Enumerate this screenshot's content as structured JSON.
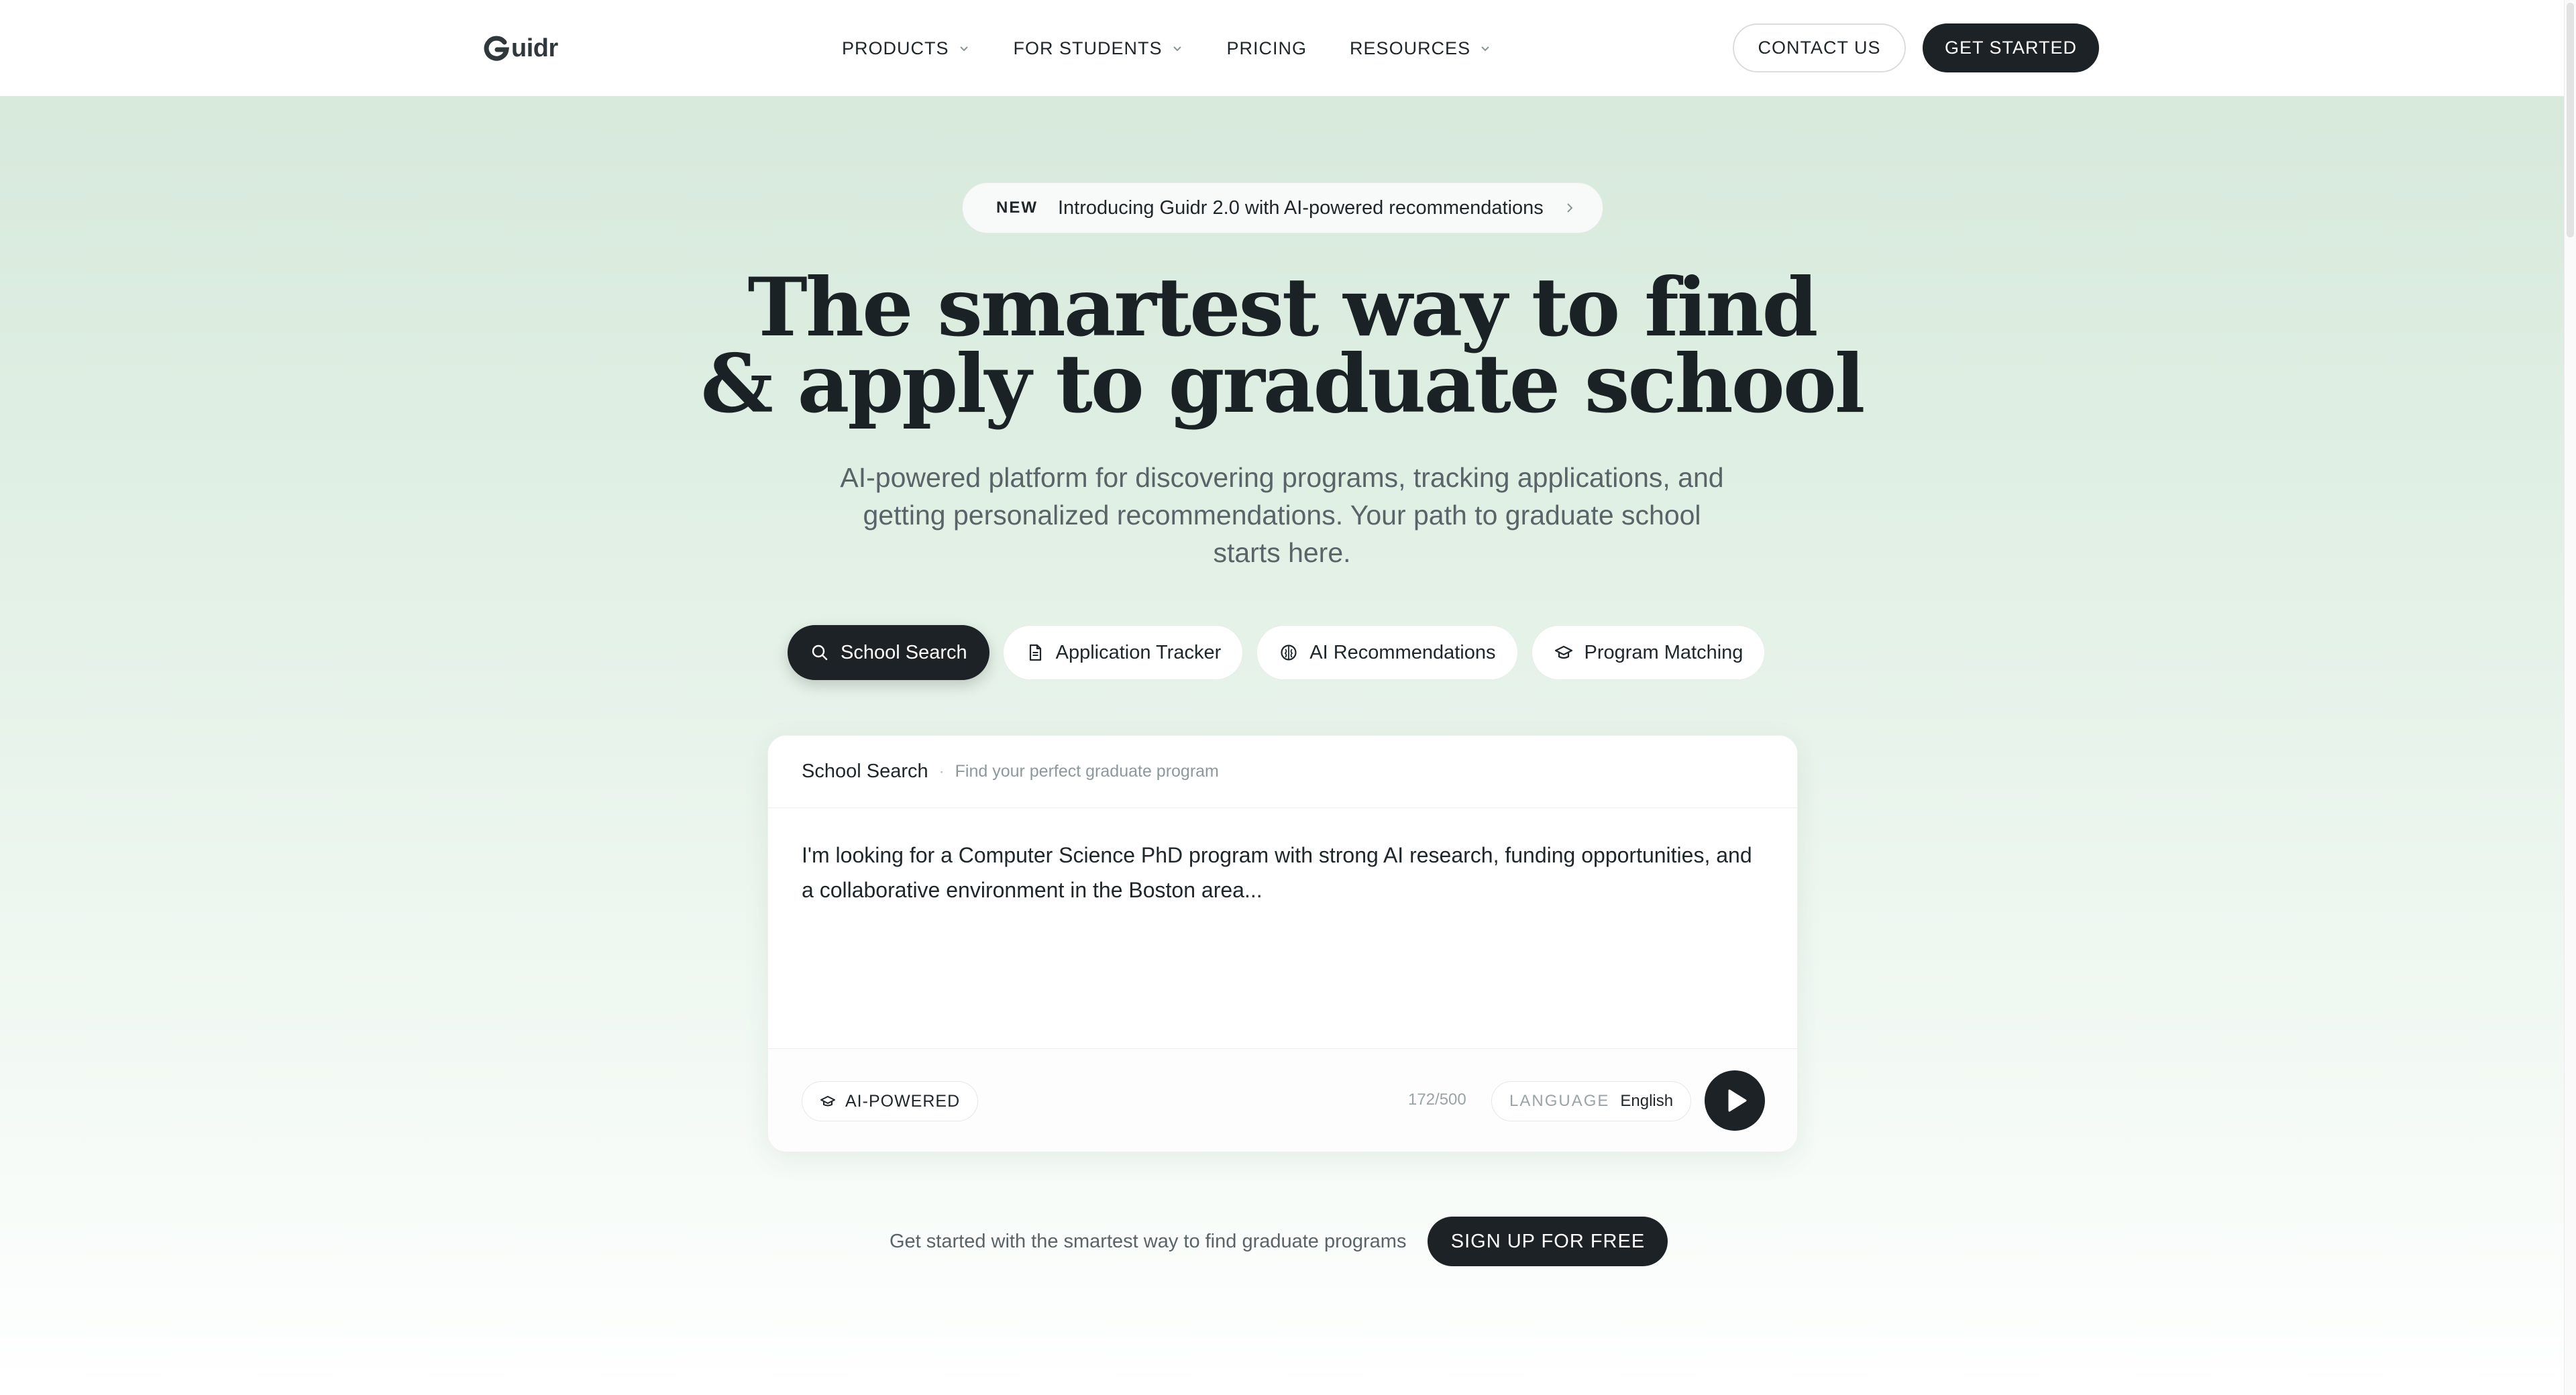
{
  "nav": {
    "logo": "uidr",
    "menu": [
      {
        "label": "PRODUCTS",
        "has_dropdown": true
      },
      {
        "label": "FOR STUDENTS",
        "has_dropdown": true
      },
      {
        "label": "PRICING",
        "has_dropdown": false
      },
      {
        "label": "RESOURCES",
        "has_dropdown": true
      }
    ],
    "contact_label": "CONTACT US",
    "get_started_label": "GET STARTED"
  },
  "announcement": {
    "badge": "NEW",
    "text": "Introducing Guidr 2.0 with AI-powered recommendations",
    "icon": "chevron-right-icon"
  },
  "hero": {
    "headline_line1": "The smartest way to find",
    "headline_line2": "& apply to graduate school",
    "subheadline": "AI-powered platform for discovering programs, tracking applications, and getting personalized recommendations. Your path to graduate school starts here."
  },
  "tabs": [
    {
      "label": "School Search",
      "icon": "search-icon",
      "active": true
    },
    {
      "label": "Application Tracker",
      "icon": "document-icon",
      "active": false
    },
    {
      "label": "AI Recommendations",
      "icon": "brain-icon",
      "active": false
    },
    {
      "label": "Program Matching",
      "icon": "graduation-cap-icon",
      "active": false
    }
  ],
  "search_card": {
    "title": "School Search",
    "separator": "·",
    "hint": "Find your perfect graduate program",
    "query": "I'm looking for a Computer Science PhD program with strong AI research, funding opportunities, and a collaborative environment in the Boston area...",
    "badge": "AI-POWERED",
    "char_count": "172/500",
    "language_label": "LANGUAGE",
    "language_value": "English",
    "send_icon": "play-icon"
  },
  "cta": {
    "message": "Get started with the smartest way to find graduate programs",
    "button_label": "SIGN UP FOR FREE"
  },
  "colors": {
    "dark": "#1d2226",
    "bg_green": "#d5e8da",
    "muted_text": "#5a6468"
  }
}
